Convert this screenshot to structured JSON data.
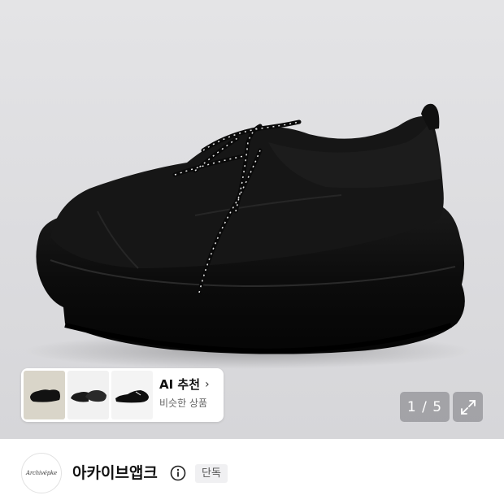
{
  "gallery": {
    "counter": "1 / 5",
    "expand_icon": "expand-icon"
  },
  "ai_recommend": {
    "title": "AI 추천",
    "chevron": "›",
    "subtitle": "비슷한 상품"
  },
  "brand": {
    "logo_text": "Archivépke",
    "name": "아카이브앱크",
    "badge": "단독",
    "info_icon": "info-icon"
  },
  "colors": {
    "background": "#dcdcdf",
    "shoe": "#141414",
    "overlay": "#78787d"
  }
}
